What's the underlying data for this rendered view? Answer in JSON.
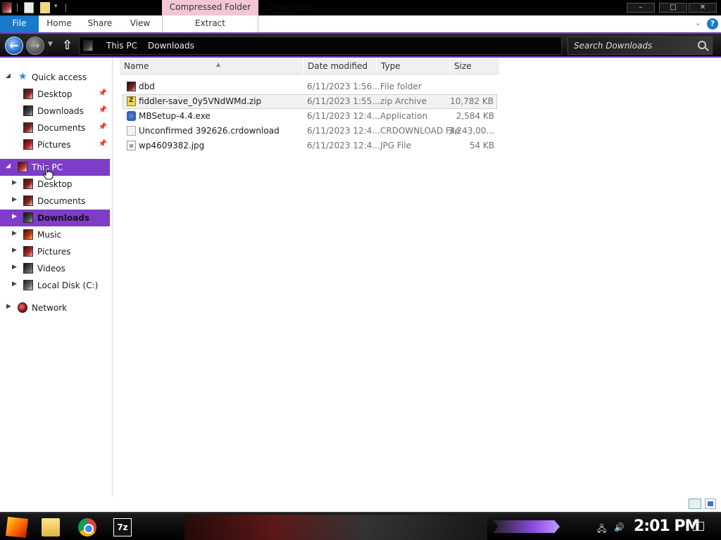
{
  "window": {
    "title": "Downloads",
    "context_tab": "Compressed Folder Tools",
    "minimize": "–",
    "maximize": "□",
    "close": "✕"
  },
  "ribbon": {
    "tabs": [
      {
        "label": "File"
      },
      {
        "label": "Home"
      },
      {
        "label": "Share"
      },
      {
        "label": "View"
      },
      {
        "label": "Extract"
      }
    ],
    "help": "?"
  },
  "address": {
    "crumbs": [
      "This PC",
      "Downloads"
    ],
    "search_placeholder": "Search Downloads"
  },
  "nav": {
    "quick_access": "Quick access",
    "quick_items": [
      {
        "label": "Desktop",
        "icon": "desktop-icon"
      },
      {
        "label": "Downloads",
        "icon": "downloads-icon"
      },
      {
        "label": "Documents",
        "icon": "documents-icon"
      },
      {
        "label": "Pictures",
        "icon": "pictures-icon"
      }
    ],
    "this_pc": "This PC",
    "pc_items": [
      {
        "label": "Desktop"
      },
      {
        "label": "Documents"
      },
      {
        "label": "Downloads"
      },
      {
        "label": "Music"
      },
      {
        "label": "Pictures"
      },
      {
        "label": "Videos"
      },
      {
        "label": "Local Disk (C:)"
      }
    ],
    "network": "Network"
  },
  "files": {
    "columns": [
      "Name",
      "Date modified",
      "Type",
      "Size"
    ],
    "rows": [
      {
        "name": "dbd",
        "date": "6/11/2023 1:56...",
        "type": "File folder",
        "size": ""
      },
      {
        "name": "fiddler-save_0y5VNdWMd.zip",
        "date": "6/11/2023 1:55...",
        "type": "zip Archive",
        "size": "10,782 KB"
      },
      {
        "name": "MBSetup-4.4.exe",
        "date": "6/11/2023 12:4...",
        "type": "Application",
        "size": "2,584 KB"
      },
      {
        "name": "Unconfirmed 392626.crdownload",
        "date": "6/11/2023 12:4...",
        "type": "CRDOWNLOAD File",
        "size": "3,243,00..."
      },
      {
        "name": "wp4609382.jpg",
        "date": "6/11/2023 12:4...",
        "type": "JPG File",
        "size": "54 KB"
      }
    ]
  },
  "taskbar": {
    "seven_zip": "7z",
    "clock": "2:01 PM"
  },
  "colors": {
    "accent_purple": "#7f3cc9",
    "file_tab_blue": "#1979ca",
    "context_pink": "#f3c6d6"
  }
}
